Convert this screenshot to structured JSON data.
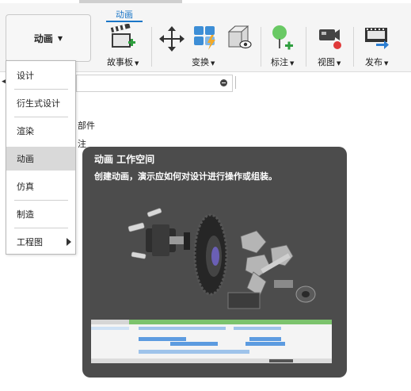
{
  "workspace_button": {
    "label": "动画"
  },
  "active_tab": {
    "label": "动画"
  },
  "toolbar_groups": [
    {
      "label": "故事板"
    },
    {
      "label": "变换"
    },
    {
      "label": "标注"
    },
    {
      "label": "视图"
    },
    {
      "label": "发布"
    }
  ],
  "browser_behind": {
    "text1": "部件",
    "text2": "注"
  },
  "workspace_menu": {
    "items": [
      {
        "label": "设计"
      },
      {
        "label": "衍生式设计"
      },
      {
        "label": "渲染"
      },
      {
        "label": "动画",
        "selected": true
      },
      {
        "label": "仿真"
      },
      {
        "label": "制造"
      },
      {
        "label": "工程图",
        "has_submenu": true
      }
    ]
  },
  "tooltip": {
    "title": "动画 工作空间",
    "description": "创建动画，演示应如何对设计进行操作或组装。"
  },
  "colors": {
    "accent": "#1a76c7",
    "tooltip_bg": "#4c4c4c",
    "menu_selected": "#d9d9d9"
  },
  "icons": [
    "storyboard-icon",
    "move-icon",
    "transform-components-icon",
    "view-icon",
    "annotation-icon",
    "camera-view-icon",
    "publish-video-icon"
  ]
}
